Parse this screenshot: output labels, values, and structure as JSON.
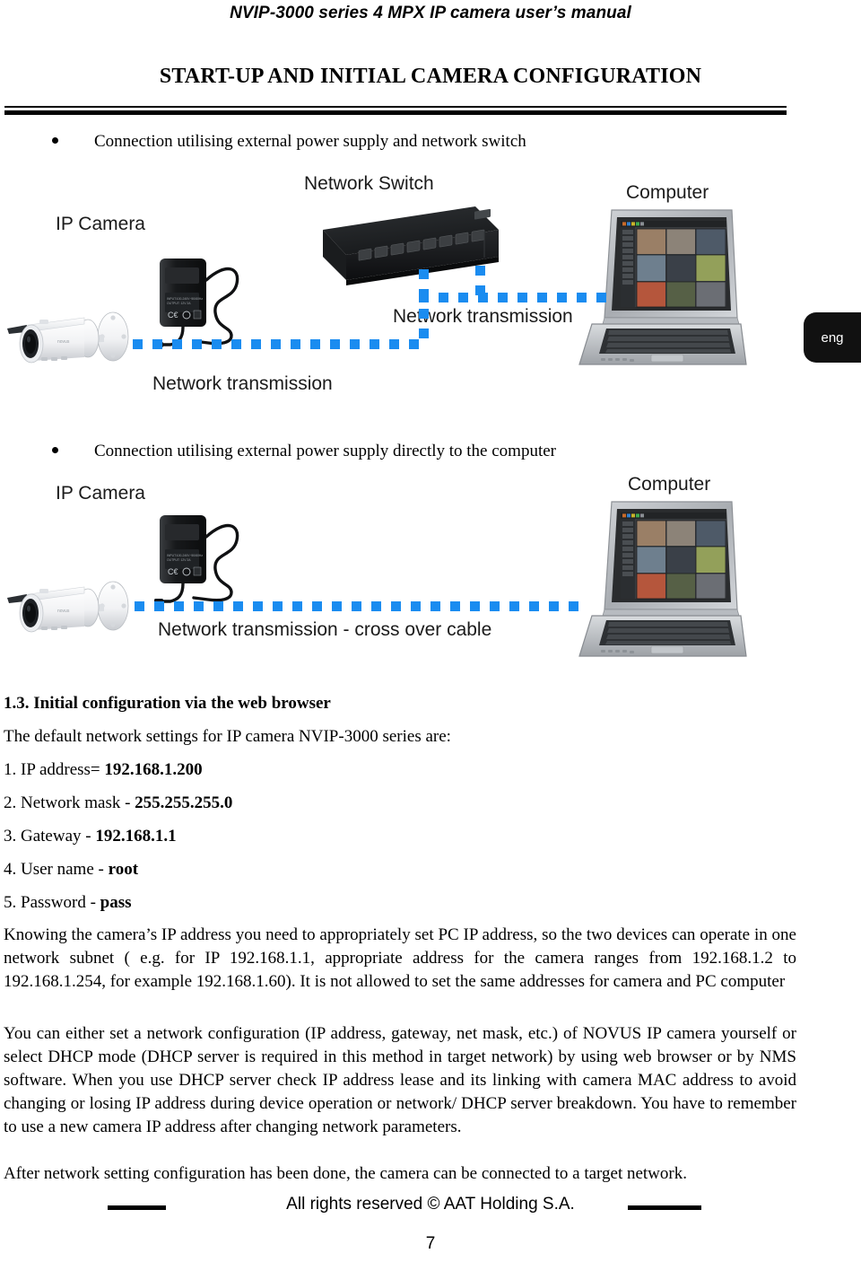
{
  "header": {
    "running_title": "NVIP-3000 series 4 MPX IP camera user’s manual",
    "chapter_title": "START-UP AND INITIAL CAMERA CONFIGURATION"
  },
  "language_tab": {
    "label": "eng"
  },
  "diagram_one": {
    "bullet": "Connection utilising external power supply and network switch",
    "label_ip_camera": "IP Camera",
    "label_network_switch": "Network Switch",
    "label_computer": "Computer",
    "label_link_upper": "Network transmission",
    "label_link_lower": "Network transmission"
  },
  "diagram_two": {
    "bullet": "Connection utilising external power supply directly to the computer",
    "label_ip_camera": "IP Camera",
    "label_computer": "Computer",
    "label_link": "Network transmission - cross over cable"
  },
  "section": {
    "number": "1.3.",
    "heading": "1.3. Initial configuration via the web browser",
    "intro": "The default network settings for IP camera  NVIP-3000 series are:",
    "settings": [
      {
        "num": "1.",
        "label": "IP address=",
        "value": "192.168.1.200"
      },
      {
        "num": "2.",
        "label": "Network mask -",
        "value": "255.255.255.0"
      },
      {
        "num": "3.",
        "label": "Gateway -",
        "value": "192.168.1.1"
      },
      {
        "num": "4.",
        "label": "User name -",
        "value": "root"
      },
      {
        "num": "5.",
        "label": "Password -",
        "value": "pass"
      }
    ],
    "paragraph_1": "Knowing the camera’s IP address you need to appropriately set PC IP address, so the two devices can operate in one network subnet ( e.g. for IP 192.168.1.1, appropriate address for the camera ranges from 192.168.1.2 to 192.168.1.254, for example 192.168.1.60). It is not allowed to set the same addresses for camera and PC computer",
    "paragraph_2": "You can either set a network configuration (IP address, gateway, net mask, etc.) of NOVUS IP camera yourself or select DHCP mode (DHCP server is required in this method in target network) by using web browser or by NMS software. When you use DHCP server check IP address lease and its linking with camera MAC address to avoid changing or losing IP address during device operation or network/ DHCP server breakdown. You have to remember to use a new camera IP address after changing network parameters.",
    "paragraph_3": "After network setting configuration has been done, the camera can be connected to a target network."
  },
  "footer": {
    "copyright": "All rights reserved © AAT Holding S.A.",
    "page_number": "7"
  },
  "colors": {
    "network_link": "#1a8cf0",
    "tab_background": "#111111",
    "text": "#000000"
  }
}
